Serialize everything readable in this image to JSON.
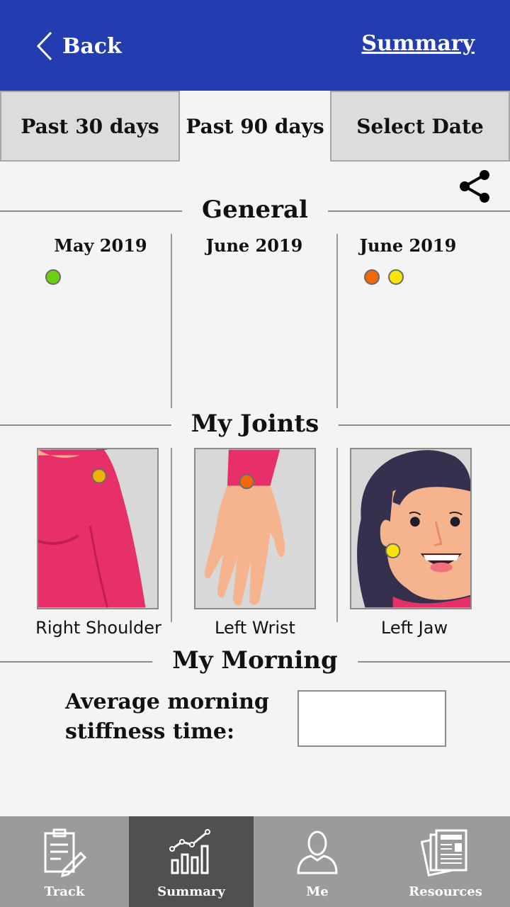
{
  "header": {
    "back_label": "Back",
    "summary_label": "Summary"
  },
  "tabs": [
    {
      "label": "Past 30 days",
      "active": false
    },
    {
      "label": "Past 90 days",
      "active": true
    },
    {
      "label": "Select Date",
      "active": false
    }
  ],
  "sections": {
    "general": "General",
    "joints": "My Joints",
    "morning": "My Morning"
  },
  "general": {
    "months": [
      {
        "label": "May 2019",
        "dots": [
          "green"
        ]
      },
      {
        "label": "June 2019",
        "dots": []
      },
      {
        "label": "June 2019",
        "dots": [
          "orange",
          "yellow"
        ]
      }
    ]
  },
  "joints": [
    {
      "label": "Right Shoulder",
      "marker": "orange-yellow"
    },
    {
      "label": "Left Wrist",
      "marker": "orange"
    },
    {
      "label": "Left Jaw",
      "marker": "yellow"
    }
  ],
  "morning": {
    "label_line1": "Average morning",
    "label_line2": "stiffness time:",
    "value": ""
  },
  "nav": [
    {
      "label": "Track",
      "icon": "clipboard-pencil-icon",
      "active": false
    },
    {
      "label": "Summary",
      "icon": "chart-icon",
      "active": true
    },
    {
      "label": "Me",
      "icon": "person-icon",
      "active": false
    },
    {
      "label": "Resources",
      "icon": "documents-icon",
      "active": false
    }
  ],
  "colors": {
    "header_bg": "#233db0",
    "green": "#6ccf12",
    "orange": "#f0680a",
    "yellow": "#f7e40b",
    "orange_yellow": "#f2b100",
    "nav_bg": "#9b9b9b",
    "nav_active": "#505050"
  }
}
